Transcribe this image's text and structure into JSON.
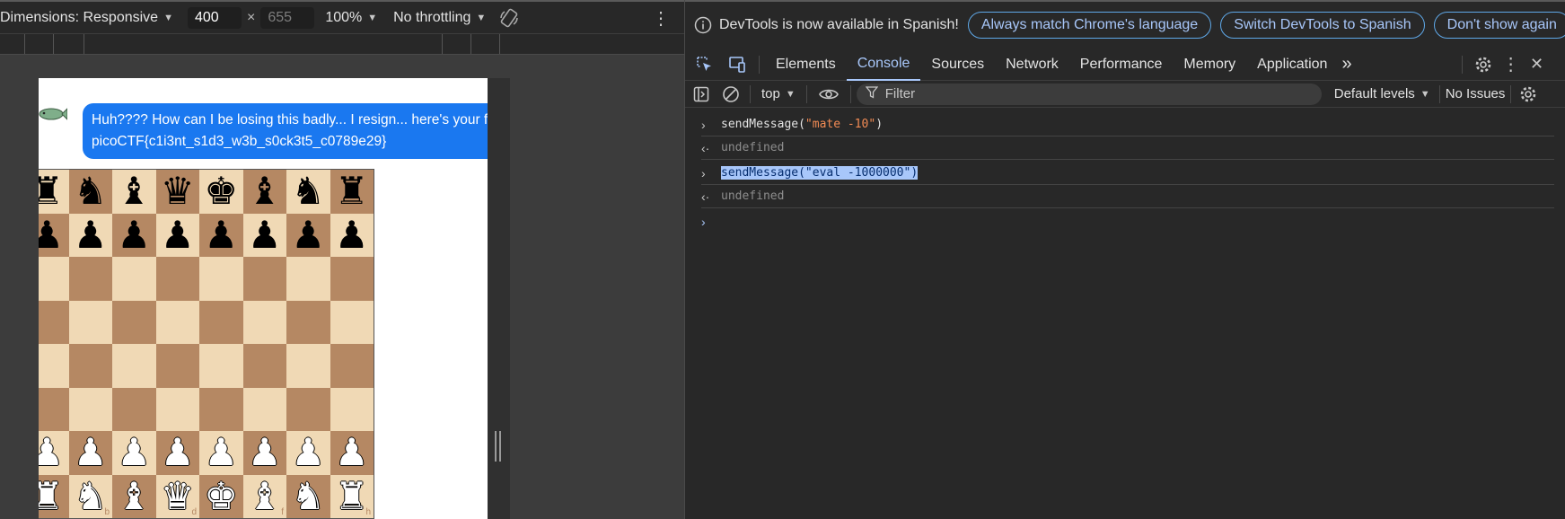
{
  "device_toolbar": {
    "dimensions_label": "Dimensions: Responsive",
    "width_value": "400",
    "times": "×",
    "height_value": "655",
    "zoom": "100%",
    "throttling": "No throttling"
  },
  "page": {
    "message_line1": "Huh???? How can I be losing this badly... I resign... here's your flag",
    "message_line2": "picoCTF{c1i3nt_s1d3_w3b_s0ck3t5_c0789e29}",
    "board_files": [
      "a",
      "b",
      "c",
      "d",
      "e",
      "f",
      "g",
      "h"
    ]
  },
  "devtools": {
    "info_message": "DevTools is now available in Spanish!",
    "btn_match": "Always match Chrome's language",
    "btn_switch": "Switch DevTools to Spanish",
    "btn_dismiss": "Don't show again",
    "tabs": [
      "Elements",
      "Console",
      "Sources",
      "Network",
      "Performance",
      "Memory",
      "Application"
    ],
    "more_tabs": "»",
    "context": "top",
    "filter_placeholder": "Filter",
    "levels": "Default levels",
    "issues": "No Issues"
  },
  "console": {
    "entries": [
      {
        "type": "input",
        "fn": "sendMessage(",
        "arg": "\"mate -10\"",
        "close": ")"
      },
      {
        "type": "result",
        "text": "undefined"
      },
      {
        "type": "input",
        "fn": "sendMessage(",
        "arg": "\"eval -1000000\"",
        "close": ")"
      },
      {
        "type": "result",
        "text": "undefined"
      }
    ]
  },
  "colors": {
    "bubble": "#1a78f0",
    "board_light": "#f0d9b5",
    "board_dark": "#b58863",
    "accent": "#a8c7fa"
  }
}
